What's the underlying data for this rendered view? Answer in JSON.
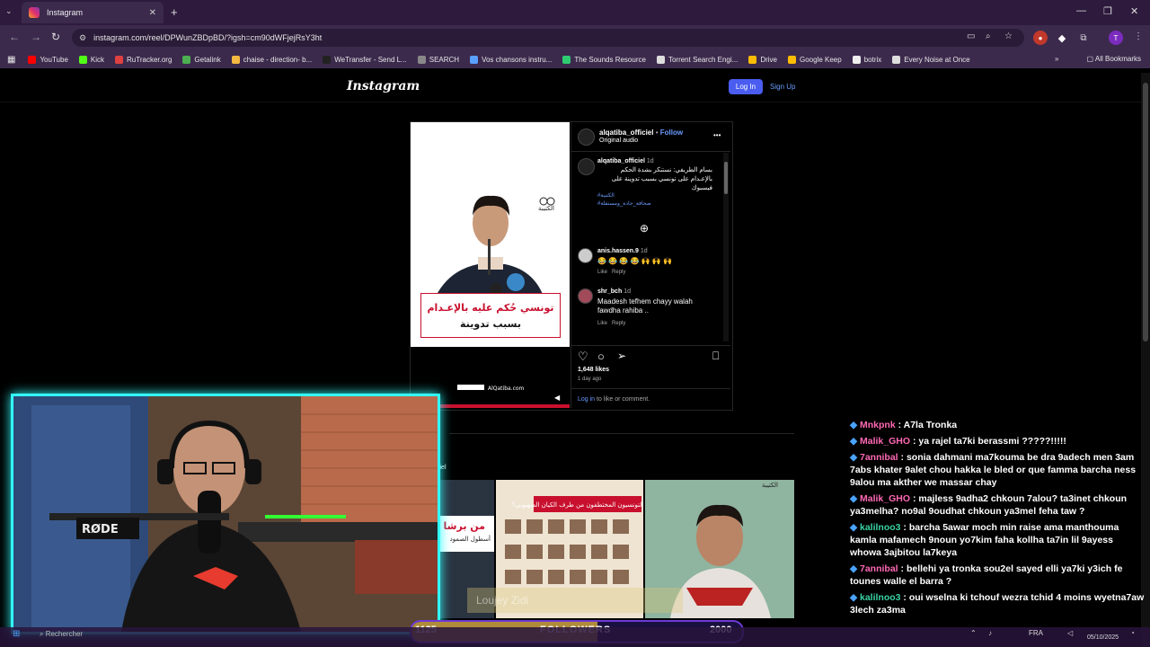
{
  "browser": {
    "tab_title": "Instagram",
    "tab_close": "✕",
    "new_tab": "+",
    "url": "instagram.com/reel/DPWunZBDpBD/?igsh=cm90dWFjejRsY3ht",
    "profile_initial": "T",
    "window_controls": [
      "—",
      "❐",
      "✕"
    ],
    "bookmarks": [
      {
        "label": "YouTube",
        "color": "#ff0000"
      },
      {
        "label": "Kick",
        "color": "#53fc18"
      },
      {
        "label": "RuTracker.org",
        "color": "#e04040"
      },
      {
        "label": "Getalink",
        "color": "#4caf50"
      },
      {
        "label": "chaise - direction- b...",
        "color": "#f5b942"
      },
      {
        "label": "WeTransfer - Send L...",
        "color": "#222"
      },
      {
        "label": "SEARCH",
        "color": "#888"
      },
      {
        "label": "Vos chansons instru...",
        "color": "#5aa0ff"
      },
      {
        "label": "The Sounds Resource",
        "color": "#2ecc71"
      },
      {
        "label": "Torrent Search Engi...",
        "color": "#ddd"
      },
      {
        "label": "Drive",
        "color": "#fbbc04"
      },
      {
        "label": "Google Keep",
        "color": "#fbbc04"
      },
      {
        "label": "botrix",
        "color": "#eee"
      },
      {
        "label": "Every Noise at Once",
        "color": "#ddd"
      }
    ],
    "all_bookmarks": "All Bookmarks"
  },
  "instagram": {
    "logo": "Instagram",
    "login": "Log In",
    "signup": "Sign Up",
    "post": {
      "username": "alqatiba_officiel",
      "follow": "Follow",
      "audio": "Original audio",
      "more": "•••",
      "caption_user": "alqatiba_officiel",
      "caption_time": "1d",
      "caption": "بسام الطريفي: نستنكر بشدة الحكم بالإعـدام على تونسي بسبب تدوينة على فيسبوك",
      "hashtag1": "#الكتيبة",
      "hashtag2": "#صحافة_جادة_ومستقلة",
      "headline_line1": "تونسي حُكم عليه بالإعـدام",
      "headline_line2": "بسبب تدوينة",
      "logo_text": "الكتيبة",
      "site": "AlQatiba.com",
      "comments": [
        {
          "user": "anis.hassen.9",
          "time": "1d",
          "text": "😂 😂 😂 😂 🙌 🙌 🙌",
          "like": "Like",
          "reply": "Reply"
        },
        {
          "user": "shr_bch",
          "time": "1d",
          "text": "Maadesh tefhem chayy walah fawdha rahiba ..",
          "like": "Like",
          "reply": "Reply"
        }
      ],
      "likes": "1,648 likes",
      "time_ago": "1 day ago",
      "login_prompt_link": "Log in",
      "login_prompt_rest": " to like or comment."
    },
    "more_from": "ciel",
    "thumb2_title": "من هم التونسيون المختطفون من طرف الكيان الصهيوني؟",
    "thumb1_text": "من برشا",
    "thumb1_sub": "أسطول الصمود",
    "thumb3_text": "الكتيبة"
  },
  "stream": {
    "mic_brand": "RØDE",
    "chat": [
      {
        "user": "Mnkpnk",
        "color": "#ff69b4",
        "msg": "A7la Tronka"
      },
      {
        "user": "Malik_GHO",
        "color": "#ff69b4",
        "msg": "ya rajel ta7ki berassmi ?????!!!!!"
      },
      {
        "user": "7annibal",
        "color": "#ff69b4",
        "msg": "sonia dahmani ma7kouma be dra 9adech men 3am 7abs khater 9alet chou hakka le bled or que famma barcha ness 9alou ma akther we massar chay"
      },
      {
        "user": "Malik_GHO",
        "color": "#ff69b4",
        "msg": "majless 9adha2 chkoun 7alou? ta3inet chkoun ya3melha? no9al 9oudhat chkoun ya3mel feha taw ?"
      },
      {
        "user": "kalilnoo3",
        "color": "#3ad3a3",
        "msg": "barcha 5awar moch min raise ama manthouma kamla mafamech 9noun yo7kim faha kollha ta7in lil 9ayess whowa 3ajbitou la7keya"
      },
      {
        "user": "7annibal",
        "color": "#ff69b4",
        "msg": "bellehi ya tronka sou2el sayed elli ya7ki y3ich fe tounes walle el barra ?"
      },
      {
        "user": "kalilnoo3",
        "color": "#3ad3a3",
        "msg": "oui wselna ki tchouf wezra tchid 4 moins wyetna7aw 3lech za3ma"
      }
    ],
    "followers_label": "FOLLOWERS",
    "followers_current": "1125",
    "followers_goal": "2000",
    "followers_progress": 0.5625,
    "overlay_name": "Loujey Zidi",
    "taskbar_search": "Rechercher",
    "tray_lang": "FRA",
    "tray_date": "05/10/2025"
  }
}
